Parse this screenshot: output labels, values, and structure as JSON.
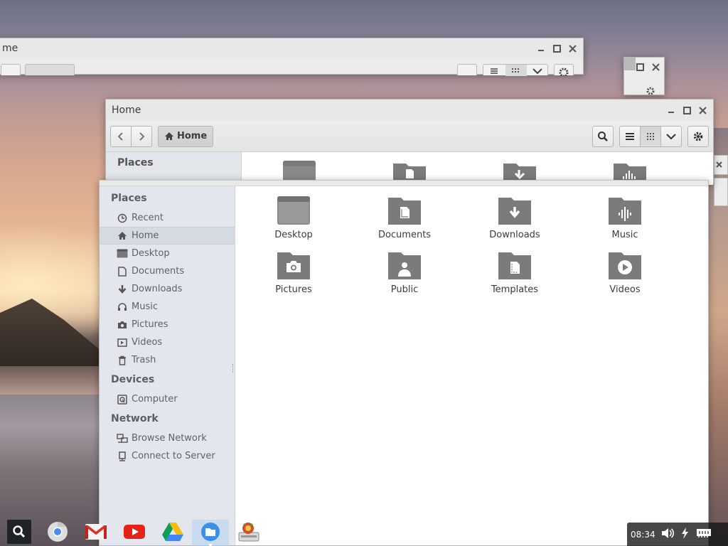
{
  "back_window": {
    "title_fragment": "me"
  },
  "mid_window": {
    "title": "Home",
    "path_button": "Home",
    "sidebar_heading": "Places"
  },
  "front_window": {
    "sidebar": {
      "places_heading": "Places",
      "places": [
        {
          "label": "Recent",
          "icon": "clock-icon"
        },
        {
          "label": "Home",
          "icon": "home-icon",
          "selected": true
        },
        {
          "label": "Desktop",
          "icon": "desktop-icon"
        },
        {
          "label": "Documents",
          "icon": "document-icon"
        },
        {
          "label": "Downloads",
          "icon": "download-icon"
        },
        {
          "label": "Music",
          "icon": "headphones-icon"
        },
        {
          "label": "Pictures",
          "icon": "camera-icon"
        },
        {
          "label": "Videos",
          "icon": "film-icon"
        },
        {
          "label": "Trash",
          "icon": "trash-icon"
        }
      ],
      "devices_heading": "Devices",
      "devices": [
        {
          "label": "Computer",
          "icon": "drive-icon"
        }
      ],
      "network_heading": "Network",
      "network": [
        {
          "label": "Browse Network",
          "icon": "network-icon"
        },
        {
          "label": "Connect to Server",
          "icon": "server-icon"
        }
      ]
    },
    "folders": [
      {
        "label": "Desktop",
        "icon": "desktop-folder-icon"
      },
      {
        "label": "Documents",
        "icon": "documents-folder-icon"
      },
      {
        "label": "Downloads",
        "icon": "downloads-folder-icon"
      },
      {
        "label": "Music",
        "icon": "music-folder-icon"
      },
      {
        "label": "Pictures",
        "icon": "pictures-folder-icon"
      },
      {
        "label": "Public",
        "icon": "public-folder-icon"
      },
      {
        "label": "Templates",
        "icon": "templates-folder-icon"
      },
      {
        "label": "Videos",
        "icon": "videos-folder-icon"
      }
    ]
  },
  "shelf": {
    "apps": [
      "search-icon",
      "chrome-icon",
      "gmail-icon",
      "youtube-icon",
      "drive-icon",
      "files-icon",
      "crouton-icon"
    ],
    "clock": "08:34"
  },
  "colors": {
    "folder": "#7b7b7b",
    "folder_tab": "#8e8e8e",
    "sidebar_bg": "#e3e7ed",
    "selected_row": "#d4dae2"
  }
}
